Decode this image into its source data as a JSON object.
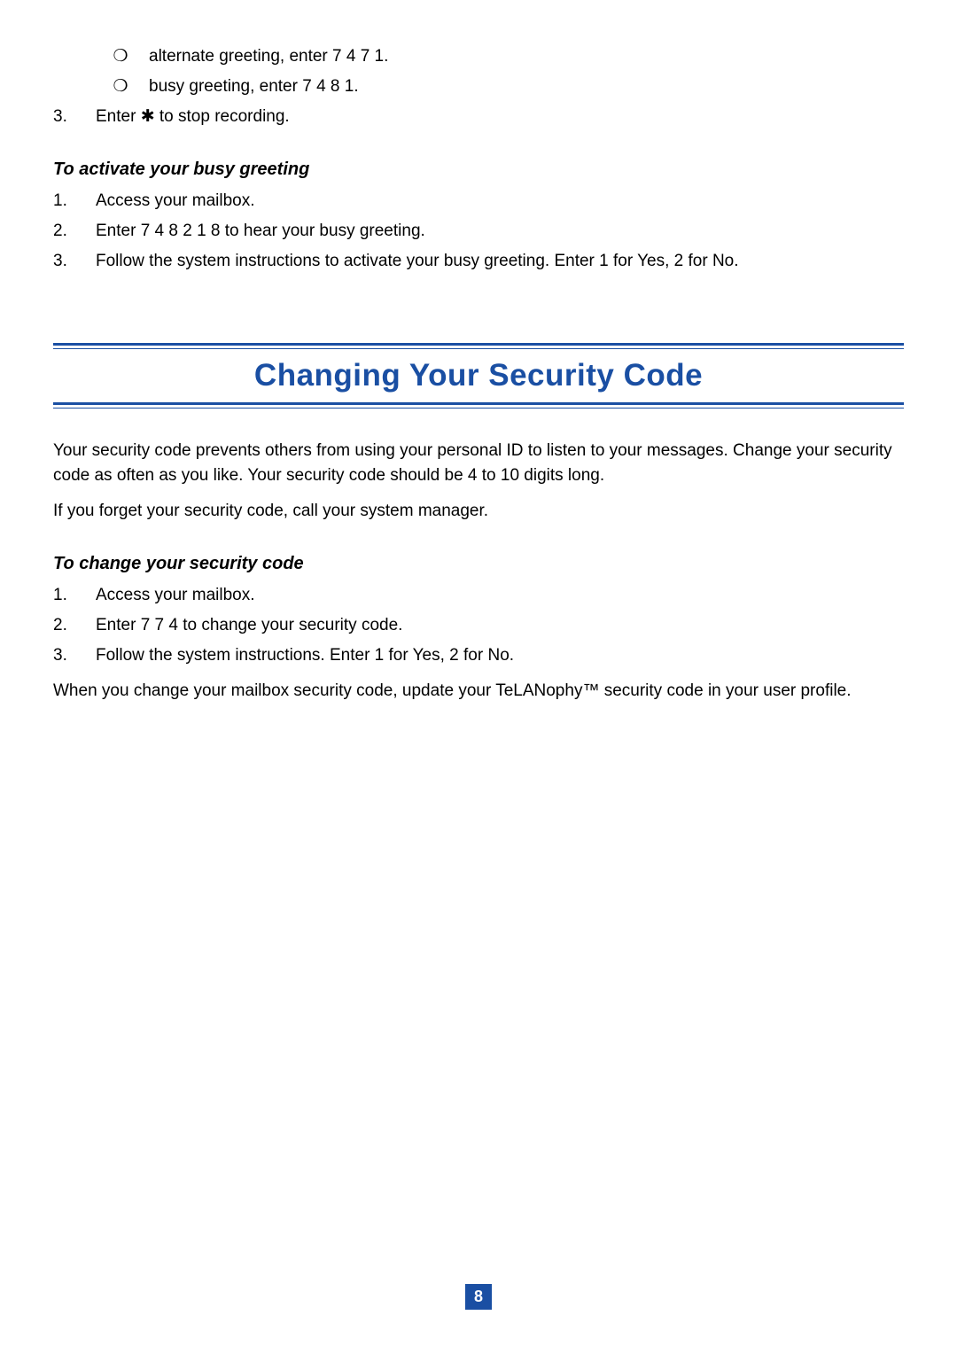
{
  "top_bullets": [
    {
      "marker": "❍",
      "text": "alternate greeting, enter 7 4 7 1."
    },
    {
      "marker": "❍",
      "text": "busy greeting, enter 7 4 8 1."
    }
  ],
  "top_step": {
    "num": "3.",
    "prefix": "Enter ",
    "symbol": "✱",
    "suffix": " to stop recording."
  },
  "activate": {
    "heading": "To activate your busy greeting",
    "steps": [
      {
        "num": "1.",
        "text": "Access your mailbox."
      },
      {
        "num": "2.",
        "text": "Enter 7 4 8 2 1 8 to hear your busy greeting."
      },
      {
        "num": "3.",
        "text": "Follow the system instructions to activate your busy greeting.  Enter 1 for Yes, 2 for No."
      }
    ]
  },
  "section_title": "Changing Your Security Code",
  "intro_para_1": "Your security code prevents others from using your personal ID to listen to your messages.  Change your security code as often as you like. Your security code should be 4 to 10 digits long.",
  "intro_para_2": "If you forget your security code, call your system manager.",
  "change": {
    "heading": "To change your security code",
    "steps": [
      {
        "num": "1.",
        "text": "Access your mailbox."
      },
      {
        "num": "2.",
        "text": "Enter 7 7 4 to change your security code."
      },
      {
        "num": "3.",
        "text": "Follow the system instructions. Enter 1 for Yes, 2 for No."
      }
    ]
  },
  "closing_para": "When you change your mailbox security code, update your TeLANophy™ security code in your user profile.",
  "page_number": "8"
}
